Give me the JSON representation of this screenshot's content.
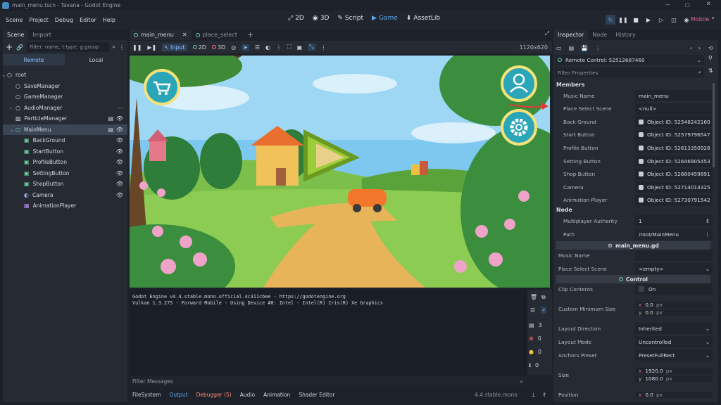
{
  "window": {
    "title": "main_menu.tscn - Tavana - Godot Engine"
  },
  "menubar": {
    "items": [
      "Scene",
      "Project",
      "Debug",
      "Editor",
      "Help"
    ],
    "main_tabs": [
      {
        "label": "2D"
      },
      {
        "label": "3D"
      },
      {
        "label": "Script"
      },
      {
        "label": "Game",
        "active": true
      },
      {
        "label": "AssetLib"
      }
    ],
    "renderer": "Mobile"
  },
  "scene_dock": {
    "tabs": [
      "Scene",
      "Import"
    ],
    "filter_placeholder": "Filter: name, t:type, g:group",
    "remote_label": "Remote",
    "local_label": "Local",
    "nodes": [
      {
        "name": "root",
        "depth": 0,
        "icon": "node-icon"
      },
      {
        "name": "SaveManager",
        "depth": 1
      },
      {
        "name": "GameManager",
        "depth": 1
      },
      {
        "name": "AudioManager",
        "depth": 1
      },
      {
        "name": "ParticleManager",
        "depth": 1
      },
      {
        "name": "MainMenu",
        "depth": 1,
        "selected": true
      },
      {
        "name": "BackGround",
        "depth": 2
      },
      {
        "name": "StartButton",
        "depth": 2
      },
      {
        "name": "ProfileButton",
        "depth": 2
      },
      {
        "name": "SettingButton",
        "depth": 2
      },
      {
        "name": "ShopButton",
        "depth": 2
      },
      {
        "name": "Camera",
        "depth": 2
      },
      {
        "name": "AnimationPlayer",
        "depth": 2
      }
    ]
  },
  "editor_tabs": [
    "main_menu",
    "place_select"
  ],
  "game_toolbar": {
    "input": "Input",
    "two_d": "2D",
    "three_d": "3D",
    "resolution": "1120x620"
  },
  "output": {
    "lines": [
      "Godot Engine v4.4.stable.mono.official.4c311cbee - https://godotengine.org",
      "Vulkan 1.3.275 - Forward Mobile - Using Device #0: Intel - Intel(R) Iris(R) Xe Graphics"
    ],
    "filter_placeholder": "Filter Messages",
    "counts": [
      "3",
      "0",
      "0",
      "0"
    ]
  },
  "bottom_tabs": {
    "filesystem": "FileSystem",
    "output": "Output",
    "debugger": "Debugger (5)",
    "audio": "Audio",
    "animation": "Animation",
    "shader": "Shader Editor",
    "version": "4.4.stable.mono"
  },
  "inspector": {
    "tabs": [
      "Inspector",
      "Node",
      "History"
    ],
    "remote": "Remote Control: 52512687460",
    "filter_placeholder": "Filter Properties",
    "members_label": "Members",
    "members": [
      {
        "k": "Music Name",
        "v": "main_menu"
      },
      {
        "k": "Place Select Scene",
        "v": "<null>"
      },
      {
        "k": "Back Ground",
        "v": "Object ID: 52546242160"
      },
      {
        "k": "Start Button",
        "v": "Object ID: 52579796547"
      },
      {
        "k": "Profile Button",
        "v": "Object ID: 52613350928"
      },
      {
        "k": "Setting Button",
        "v": "Object ID: 52646905453"
      },
      {
        "k": "Shop Button",
        "v": "Object ID: 52680459891"
      },
      {
        "k": "Camera",
        "v": "Object ID: 52714014325"
      },
      {
        "k": "Animation Player",
        "v": "Object ID: 52730791542"
      }
    ],
    "node_label": "Node",
    "node_props": [
      {
        "k": "Multiplayer Authority",
        "v": "1"
      },
      {
        "k": "Path",
        "v": "/root/MainMenu"
      }
    ],
    "script_cat": "main_menu.gd",
    "script_props": [
      {
        "k": "Music Name",
        "v": ""
      },
      {
        "k": "Place Select Scene",
        "v": "<empty>"
      }
    ],
    "control_cat": "Control",
    "control_props": [
      {
        "k": "Clip Contents",
        "v": "On"
      },
      {
        "k": "Custom Minimum Size",
        "x": "0.0",
        "y": "0.0",
        "unit": "px"
      },
      {
        "k": "Layout Direction",
        "v": "Inherited"
      },
      {
        "k": "Layout Mode",
        "v": "Uncontrolled"
      },
      {
        "k": "Anchors Preset",
        "v": "PresetFullRect"
      },
      {
        "k": "Size",
        "x": "1920.0",
        "y": "1080.0",
        "unit": "px"
      },
      {
        "k": "Position",
        "x": "0.0",
        "unit": "px"
      }
    ]
  }
}
